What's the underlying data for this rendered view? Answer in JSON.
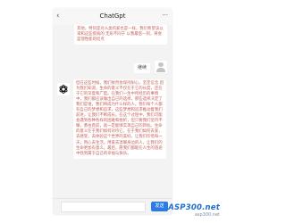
{
  "app": {
    "title": "ChatGpt",
    "back_glyph": "‹",
    "more_glyph": "···"
  },
  "messages": [
    {
      "role": "assistant",
      "text": "够有效地分析出来的信息，并根据这一规律发现了其他，特别是对人类的爱也是一样，我们希望该以来和这些疾病的 无形不同于 以我最后一刻，将会是理性能的结点"
    },
    {
      "role": "user",
      "text": "继续"
    },
    {
      "role": "assistant",
      "text": "但在这些时候，我们依然会保持耐心，坚定信念 因为我们知道，生命的意义不仅在于它的长度，还在于它的深度和广度。在我们一生中所经历的事情中，我们都应该做出自己的选择，那些选择决定了我们是谁，我们将成为什么样的人。我们每个人都有自己的梦想和追求，这些梦想和追求推动着我们前进，让我们不断成长。在这个过程中，我们可能会遇到各种各样的困难和挫折，但只要我们坚持不懈，勇往直前，就一定能够实现自己的目标。生命的意义在于我们如何对待它，在于我们如何去爱，去感受，去体验这个世界的美好。让我们珍惜每一天，用心去生活，用爱去温暖身边的人，让我们的生命更加有意义。最后，愿我们都能在人生的旅途中找到属于自己的幸福与快乐。"
    }
  ],
  "input": {
    "placeholder": "",
    "value": ""
  },
  "send_label": "发送",
  "watermark": {
    "logo_a": "ASP",
    "logo_b": "300",
    "logo_c": ".net",
    "site": "asp300.net"
  },
  "colors": {
    "accent": "#2a7be6",
    "assistant_text": "#c4605a",
    "background": "#f3f3f3"
  },
  "icons": {
    "assistant_avatar": "openai-logo-icon",
    "user_avatar": "user-avatar-icon"
  }
}
